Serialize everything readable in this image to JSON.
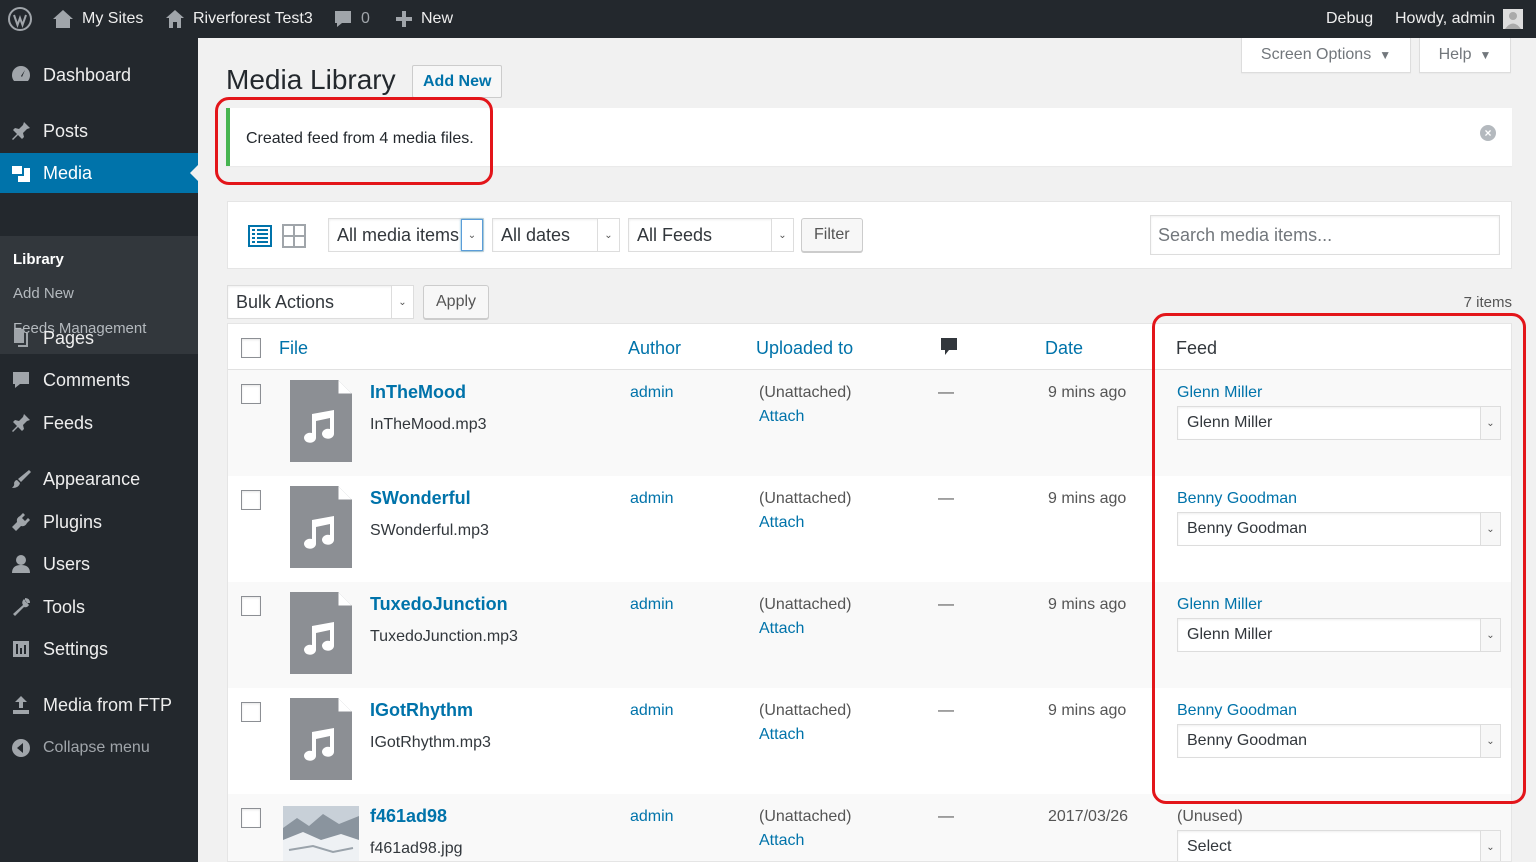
{
  "adminbar": {
    "my_sites": "My Sites",
    "site_name": "Riverforest Test3",
    "comments_count": "0",
    "new_label": "New",
    "debug": "Debug",
    "howdy": "Howdy, admin"
  },
  "sidebar": {
    "items": [
      {
        "label": "Dashboard",
        "icon": "dashboard-icon"
      },
      {
        "label": "Posts",
        "icon": "pin-icon"
      },
      {
        "label": "Media",
        "icon": "media-icon"
      },
      {
        "label": "Pages",
        "icon": "pages-icon"
      },
      {
        "label": "Comments",
        "icon": "comment-icon"
      },
      {
        "label": "Feeds",
        "icon": "pin-icon"
      },
      {
        "label": "Appearance",
        "icon": "brush-icon"
      },
      {
        "label": "Plugins",
        "icon": "plug-icon"
      },
      {
        "label": "Users",
        "icon": "user-icon"
      },
      {
        "label": "Tools",
        "icon": "wrench-icon"
      },
      {
        "label": "Settings",
        "icon": "settings-icon"
      },
      {
        "label": "Media from FTP",
        "icon": "upload-icon"
      },
      {
        "label": "Collapse menu",
        "icon": "collapse-icon"
      }
    ],
    "submenu": [
      "Library",
      "Add New",
      "Feeds Management"
    ]
  },
  "header": {
    "title": "Media Library",
    "add_new": "Add New",
    "screen_options": "Screen Options",
    "help": "Help"
  },
  "notice": {
    "message": "Created feed from 4 media files."
  },
  "filters": {
    "media_type": "All media items",
    "dates": "All dates",
    "feeds": "All Feeds",
    "filter_button": "Filter",
    "search_placeholder": "Search media items..."
  },
  "bulk": {
    "actions": "Bulk Actions",
    "apply": "Apply",
    "items_count": "7 items"
  },
  "table": {
    "columns": {
      "file": "File",
      "author": "Author",
      "uploaded_to": "Uploaded to",
      "date": "Date",
      "feed": "Feed"
    },
    "rows": [
      {
        "title": "InTheMood",
        "filename": "InTheMood.mp3",
        "author": "admin",
        "uploaded": "(Unattached)",
        "attach": "Attach",
        "comments": "—",
        "date": "9 mins ago",
        "feed_link": "Glenn Miller",
        "feed_select": "Glenn Miller",
        "thumb": "audio"
      },
      {
        "title": "SWonderful",
        "filename": "SWonderful.mp3",
        "author": "admin",
        "uploaded": "(Unattached)",
        "attach": "Attach",
        "comments": "—",
        "date": "9 mins ago",
        "feed_link": "Benny Goodman",
        "feed_select": "Benny Goodman",
        "thumb": "audio"
      },
      {
        "title": "TuxedoJunction",
        "filename": "TuxedoJunction.mp3",
        "author": "admin",
        "uploaded": "(Unattached)",
        "attach": "Attach",
        "comments": "—",
        "date": "9 mins ago",
        "feed_link": "Glenn Miller",
        "feed_select": "Glenn Miller",
        "thumb": "audio"
      },
      {
        "title": "IGotRhythm",
        "filename": "IGotRhythm.mp3",
        "author": "admin",
        "uploaded": "(Unattached)",
        "attach": "Attach",
        "comments": "—",
        "date": "9 mins ago",
        "feed_link": "Benny Goodman",
        "feed_select": "Benny Goodman",
        "thumb": "audio"
      },
      {
        "title": "f461ad98",
        "filename": "f461ad98.jpg",
        "author": "admin",
        "uploaded": "(Unattached)",
        "attach": "Attach",
        "comments": "—",
        "date": "2017/03/26",
        "feed_link": "(Unused)",
        "feed_select": "Select",
        "thumb": "image"
      }
    ]
  },
  "colors": {
    "adminbar_bg": "#23282d",
    "accent": "#0073aa",
    "notice_border": "#46b450",
    "annotation": "#e3151a"
  }
}
